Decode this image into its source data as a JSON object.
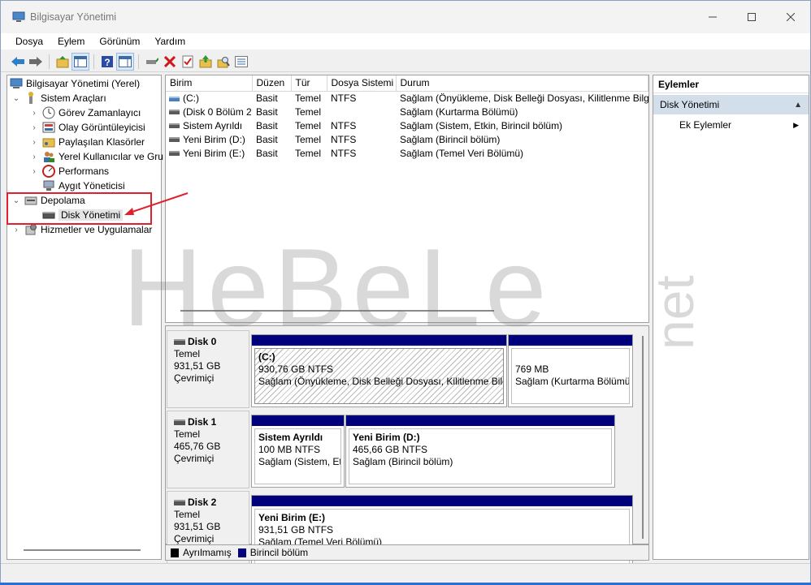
{
  "window": {
    "title": "Bilgisayar Yönetimi"
  },
  "menu": [
    "Dosya",
    "Eylem",
    "Görünüm",
    "Yardım"
  ],
  "tree": {
    "root": "Bilgisayar Yönetimi (Yerel)",
    "system_tools": "Sistem Araçları",
    "task_scheduler": "Görev Zamanlayıcı",
    "event_viewer": "Olay Görüntüleyicisi",
    "shared_folders": "Paylaşılan Klasörler",
    "local_users": "Yerel Kullanıcılar ve Gru",
    "performance": "Performans",
    "device_manager": "Aygıt Yöneticisi",
    "storage": "Depolama",
    "disk_management": "Disk Yönetimi",
    "services_apps": "Hizmetler ve Uygulamalar"
  },
  "volume_list": {
    "columns": [
      "Birim",
      "Düzen",
      "Tür",
      "Dosya Sistemi",
      "Durum"
    ],
    "rows": [
      [
        "(C:)",
        "Basit",
        "Temel",
        "NTFS",
        "Sağlam (Önyükleme, Disk Belleği Dosyası, Kilitlenme Bilgisi"
      ],
      [
        "(Disk 0 Bölüm 2)",
        "Basit",
        "Temel",
        "",
        "Sağlam (Kurtarma Bölümü)"
      ],
      [
        "Sistem Ayrıldı",
        "Basit",
        "Temel",
        "NTFS",
        "Sağlam (Sistem, Etkin, Birincil bölüm)"
      ],
      [
        "Yeni Birim (D:)",
        "Basit",
        "Temel",
        "NTFS",
        "Sağlam (Birincil bölüm)"
      ],
      [
        "Yeni Birim (E:)",
        "Basit",
        "Temel",
        "NTFS",
        "Sağlam (Temel Veri Bölümü)"
      ]
    ]
  },
  "disks": {
    "disk0": {
      "name": "Disk 0",
      "type": "Temel",
      "size": "931,51 GB",
      "status": "Çevrimiçi",
      "p1": {
        "name": "(C:)",
        "size": "930,76 GB NTFS",
        "status": "Sağlam (Önyükleme, Disk Belleği Dosyası, Kilitlenme Bilgi"
      },
      "p2": {
        "size": "769 MB",
        "status": "Sağlam (Kurtarma Bölümü)"
      }
    },
    "disk1": {
      "name": "Disk 1",
      "type": "Temel",
      "size": "465,76 GB",
      "status": "Çevrimiçi",
      "p1": {
        "name": "Sistem Ayrıldı",
        "size": "100 MB NTFS",
        "status": "Sağlam (Sistem, Etki"
      },
      "p2": {
        "name": "Yeni Birim  (D:)",
        "size": "465,66 GB NTFS",
        "status": "Sağlam (Birincil bölüm)"
      }
    },
    "disk2": {
      "name": "Disk 2",
      "type": "Temel",
      "size": "931,51 GB",
      "status": "Çevrimiçi",
      "p1": {
        "name": "Yeni Birim  (E:)",
        "size": "931,51 GB NTFS",
        "status": "Sağlam (Temel Veri Bölümü)"
      }
    }
  },
  "legend": {
    "unallocated": "Ayrılmamış",
    "primary": "Birincil bölüm",
    "unallocated_color": "#000000",
    "primary_color": "#00007c"
  },
  "actions": {
    "header": "Eylemler",
    "section": "Disk Yönetimi",
    "more": "Ek Eylemler"
  },
  "watermark": {
    "main": "HeBeLe",
    "suffix": "net"
  }
}
